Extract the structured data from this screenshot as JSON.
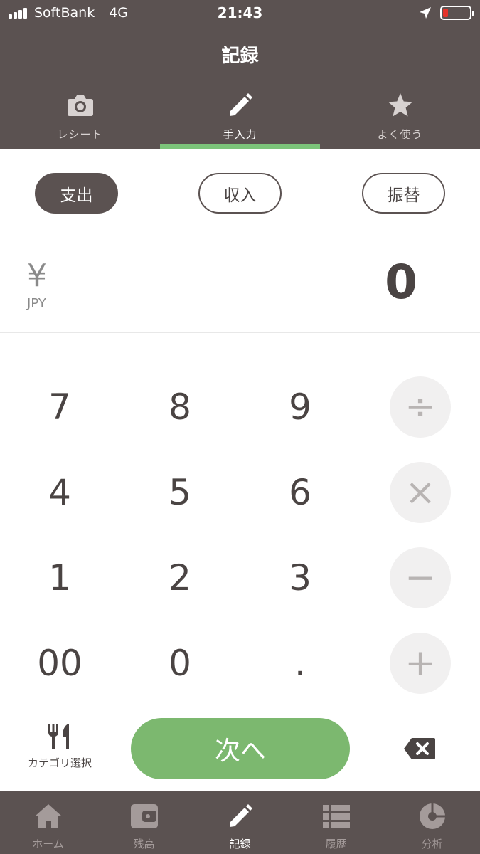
{
  "status_bar": {
    "carrier": "SoftBank",
    "network": "4G",
    "time": "21:43",
    "battery_color": "#e5332a"
  },
  "header": {
    "title": "記録"
  },
  "mode_tabs": [
    {
      "label": "レシート",
      "icon": "camera-icon"
    },
    {
      "label": "手入力",
      "icon": "pencil-icon",
      "active": true
    },
    {
      "label": "よく使う",
      "icon": "star-icon"
    }
  ],
  "type_buttons": [
    {
      "label": "支出",
      "active": true
    },
    {
      "label": "収入"
    },
    {
      "label": "振替"
    }
  ],
  "amount": {
    "symbol": "¥",
    "currency": "JPY",
    "value": "0"
  },
  "keypad": {
    "keys": [
      "7",
      "8",
      "9",
      "4",
      "5",
      "6",
      "1",
      "2",
      "3",
      "00",
      "0",
      "."
    ],
    "operators": [
      "÷",
      "×",
      "−",
      "+"
    ]
  },
  "actions": {
    "category_label": "カテゴリ選択",
    "next_label": "次へ",
    "accent_color": "#7cb86f"
  },
  "bottom_nav": [
    {
      "label": "ホーム",
      "icon": "home-icon"
    },
    {
      "label": "残高",
      "icon": "wallet-icon"
    },
    {
      "label": "記録",
      "icon": "pencil-icon",
      "active": true
    },
    {
      "label": "履歴",
      "icon": "list-icon"
    },
    {
      "label": "分析",
      "icon": "pie-chart-icon"
    }
  ]
}
